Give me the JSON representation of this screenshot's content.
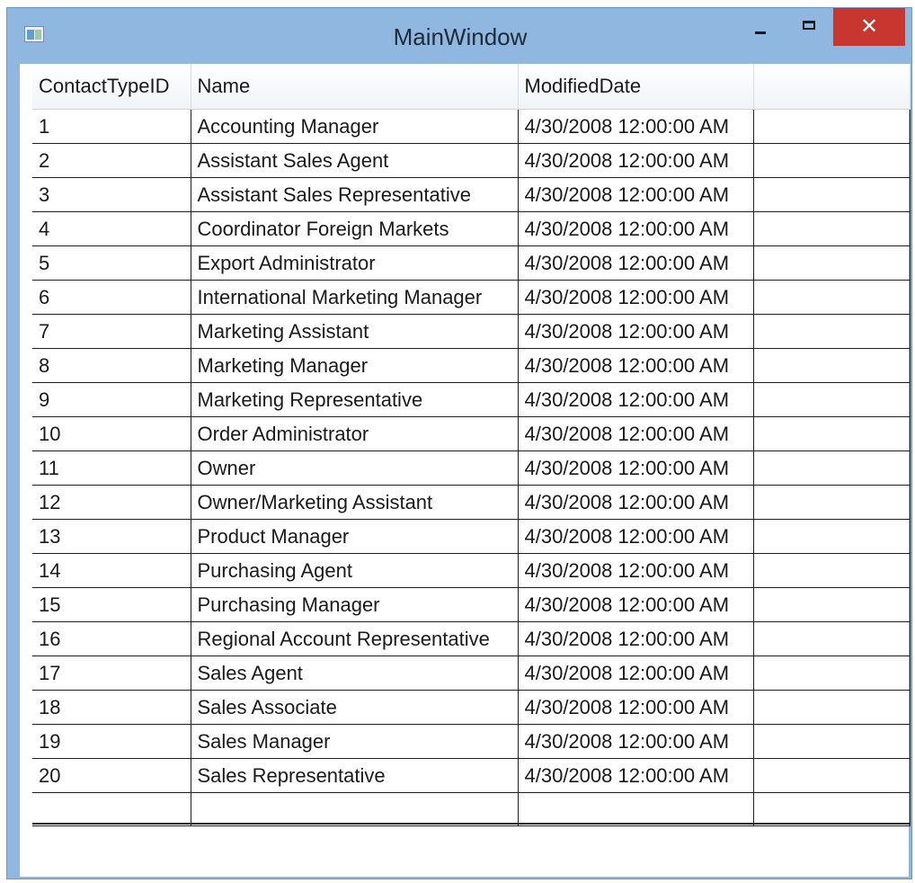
{
  "window": {
    "title": "MainWindow",
    "controls": {
      "minimize_icon": "minimize-icon",
      "maximize_icon": "maximize-icon",
      "close_icon": "close-icon",
      "close_glyph": "✕"
    }
  },
  "grid": {
    "columns": [
      "ContactTypeID",
      "Name",
      "ModifiedDate"
    ],
    "rows": [
      {
        "id": "1",
        "name": "Accounting Manager",
        "date": "4/30/2008 12:00:00 AM"
      },
      {
        "id": "2",
        "name": "Assistant Sales Agent",
        "date": "4/30/2008 12:00:00 AM"
      },
      {
        "id": "3",
        "name": "Assistant Sales Representative",
        "date": "4/30/2008 12:00:00 AM"
      },
      {
        "id": "4",
        "name": "Coordinator Foreign Markets",
        "date": "4/30/2008 12:00:00 AM"
      },
      {
        "id": "5",
        "name": "Export Administrator",
        "date": "4/30/2008 12:00:00 AM"
      },
      {
        "id": "6",
        "name": "International Marketing Manager",
        "date": "4/30/2008 12:00:00 AM"
      },
      {
        "id": "7",
        "name": "Marketing Assistant",
        "date": "4/30/2008 12:00:00 AM"
      },
      {
        "id": "8",
        "name": "Marketing Manager",
        "date": "4/30/2008 12:00:00 AM"
      },
      {
        "id": "9",
        "name": "Marketing Representative",
        "date": "4/30/2008 12:00:00 AM"
      },
      {
        "id": "10",
        "name": "Order Administrator",
        "date": "4/30/2008 12:00:00 AM"
      },
      {
        "id": "11",
        "name": "Owner",
        "date": "4/30/2008 12:00:00 AM"
      },
      {
        "id": "12",
        "name": "Owner/Marketing Assistant",
        "date": "4/30/2008 12:00:00 AM"
      },
      {
        "id": "13",
        "name": "Product Manager",
        "date": "4/30/2008 12:00:00 AM"
      },
      {
        "id": "14",
        "name": "Purchasing Agent",
        "date": "4/30/2008 12:00:00 AM"
      },
      {
        "id": "15",
        "name": "Purchasing Manager",
        "date": "4/30/2008 12:00:00 AM"
      },
      {
        "id": "16",
        "name": "Regional Account Representative",
        "date": "4/30/2008 12:00:00 AM"
      },
      {
        "id": "17",
        "name": "Sales Agent",
        "date": "4/30/2008 12:00:00 AM"
      },
      {
        "id": "18",
        "name": "Sales Associate",
        "date": "4/30/2008 12:00:00 AM"
      },
      {
        "id": "19",
        "name": "Sales Manager",
        "date": "4/30/2008 12:00:00 AM"
      },
      {
        "id": "20",
        "name": "Sales Representative",
        "date": "4/30/2008 12:00:00 AM"
      }
    ]
  }
}
